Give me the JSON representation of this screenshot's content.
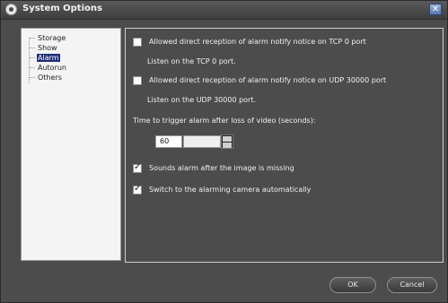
{
  "window": {
    "title": "System Options",
    "close_label": "✕"
  },
  "tree": {
    "items": [
      {
        "label": "Storage"
      },
      {
        "label": "Show"
      },
      {
        "label": "Alarm"
      },
      {
        "label": "Autorun"
      },
      {
        "label": "Others"
      }
    ],
    "selected": "Alarm"
  },
  "alarm": {
    "tcp": {
      "checked": false,
      "label": "Allowed direct reception of alarm notify notice on TCP 0 port",
      "hint": "Listen on the TCP 0 port."
    },
    "udp": {
      "checked": false,
      "label": "Allowed direct reception of alarm notify notice on UDP 30000 port",
      "hint": "Listen on the UDP 30000 port."
    },
    "trigger_time": {
      "label": "Time to trigger alarm after loss of video (seconds):",
      "value": "60"
    },
    "sound_alarm": {
      "checked": true,
      "label": "Sounds alarm after the image is missing"
    },
    "switch_camera": {
      "checked": true,
      "label": "Switch to the alarming camera automatically"
    }
  },
  "buttons": {
    "ok": "OK",
    "cancel": "Cancel"
  }
}
